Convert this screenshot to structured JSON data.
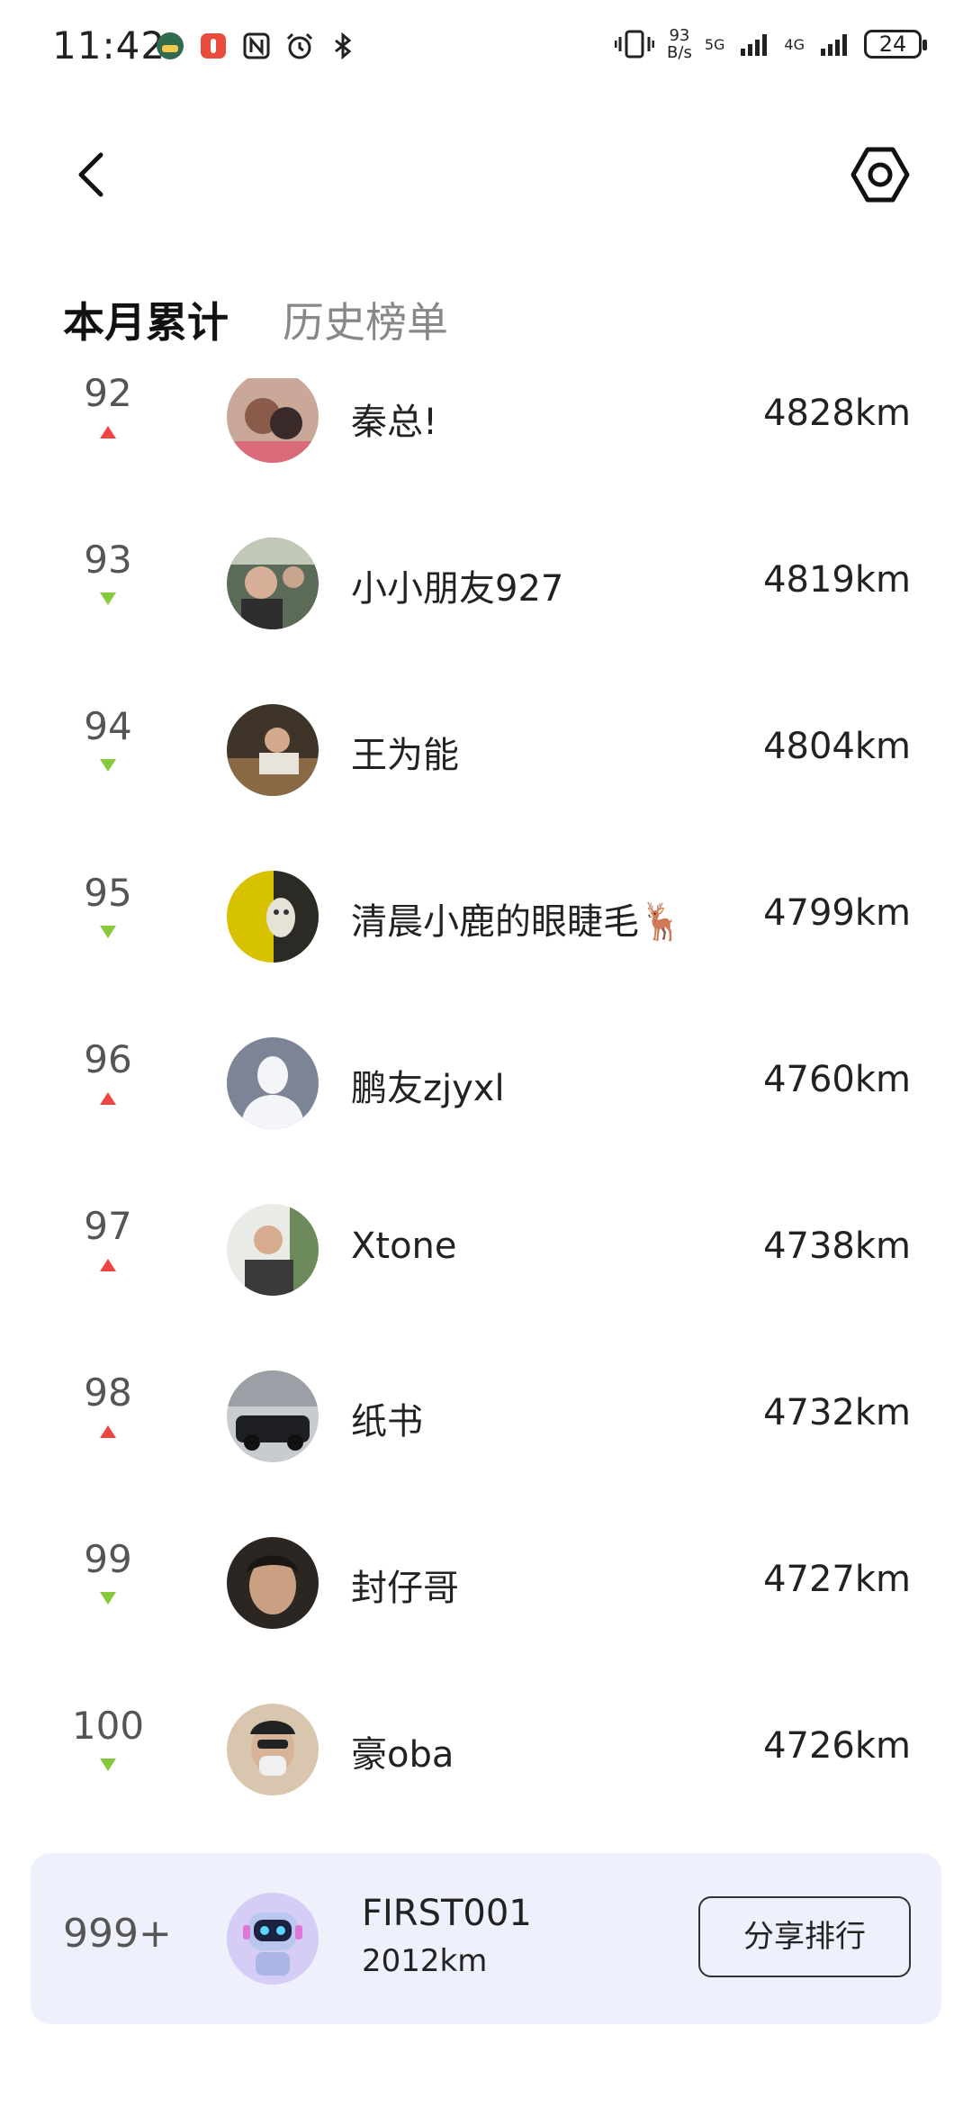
{
  "status_bar": {
    "time": "11:42",
    "net_speed_value": "93",
    "net_speed_unit": "B/s",
    "signal_1_label": "5G",
    "signal_2_label": "4G",
    "battery_level": "24"
  },
  "header": {
    "back_icon": "chevron-left-icon",
    "settings_icon": "hexagon-settings-icon"
  },
  "tabs": [
    {
      "label": "本月累计",
      "active": true
    },
    {
      "label": "历史榜单",
      "active": false
    }
  ],
  "colors": {
    "trend_up": "#ef4444",
    "trend_down": "#86c93b",
    "card_background": "#eef0fb"
  },
  "ranking": [
    {
      "rank": "92",
      "trend": "up",
      "name": "秦总!",
      "distance": "4828km"
    },
    {
      "rank": "93",
      "trend": "down",
      "name": "小小朋友927",
      "distance": "4819km"
    },
    {
      "rank": "94",
      "trend": "down",
      "name": "王为能",
      "distance": "4804km"
    },
    {
      "rank": "95",
      "trend": "down",
      "name": "清晨小鹿的眼睫毛🦌",
      "distance": "4799km"
    },
    {
      "rank": "96",
      "trend": "up",
      "name": "鹏友zjyxl",
      "distance": "4760km"
    },
    {
      "rank": "97",
      "trend": "up",
      "name": "Xtone",
      "distance": "4738km"
    },
    {
      "rank": "98",
      "trend": "up",
      "name": "纸书",
      "distance": "4732km"
    },
    {
      "rank": "99",
      "trend": "down",
      "name": "封仔哥",
      "distance": "4727km"
    },
    {
      "rank": "100",
      "trend": "down",
      "name": "豪oba",
      "distance": "4726km"
    }
  ],
  "my_rank": {
    "rank": "999+",
    "name": "FIRST001",
    "distance": "2012km",
    "share_label": "分享排行"
  }
}
